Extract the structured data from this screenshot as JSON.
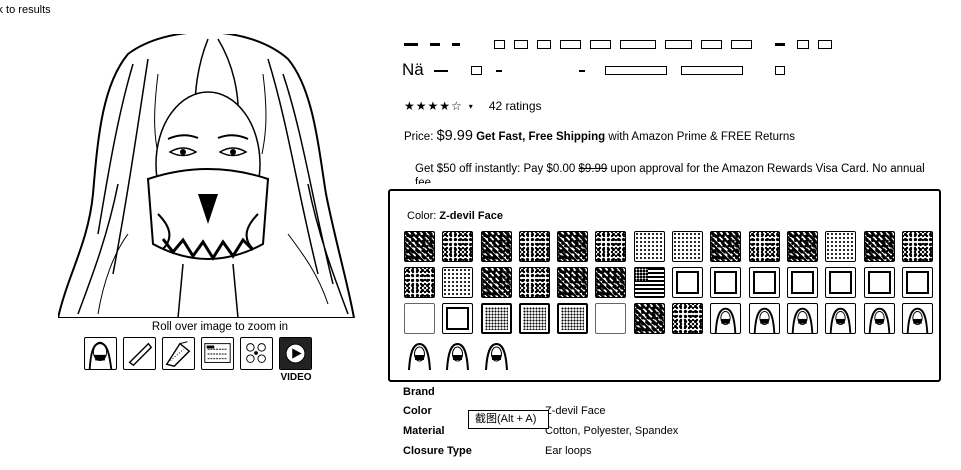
{
  "nav": {
    "back_link": "ck to results"
  },
  "gallery": {
    "zoom_hint": "Roll over image to zoom in",
    "video_label": "VIDEO",
    "thumbnails": [
      "thumbnail-face-mask",
      "thumbnail-mask-fold",
      "thumbnail-mask-side",
      "thumbnail-size-chart",
      "thumbnail-patterns",
      "thumbnail-video"
    ]
  },
  "product": {
    "title_line2": "Nä",
    "stars": "★★★★☆",
    "ratings": "42 ratings",
    "price_label": "Price:",
    "price": "$9.99",
    "shipping_bold": "Get Fast, Free Shipping",
    "shipping_rest": " with Amazon Prime & FREE Returns",
    "promo_pre": "Get $50 off instantly: Pay $0.00 ",
    "promo_struck": "$9.99",
    "promo_post": " upon approval for the Amazon Rewards Visa Card. No annual fee."
  },
  "color_selector": {
    "label": "Color:",
    "selected": "Z-devil Face"
  },
  "specs": {
    "brand_key": "Brand",
    "brand_value": "",
    "color_key": "Color",
    "color_value": "Z-devil Face",
    "material_key": "Material",
    "material_value": "Cotton, Polyester, Spandex",
    "closure_key": "Closure Type",
    "closure_value": "Ear loops"
  },
  "tooltip": {
    "text": "截图(Alt + A)"
  }
}
